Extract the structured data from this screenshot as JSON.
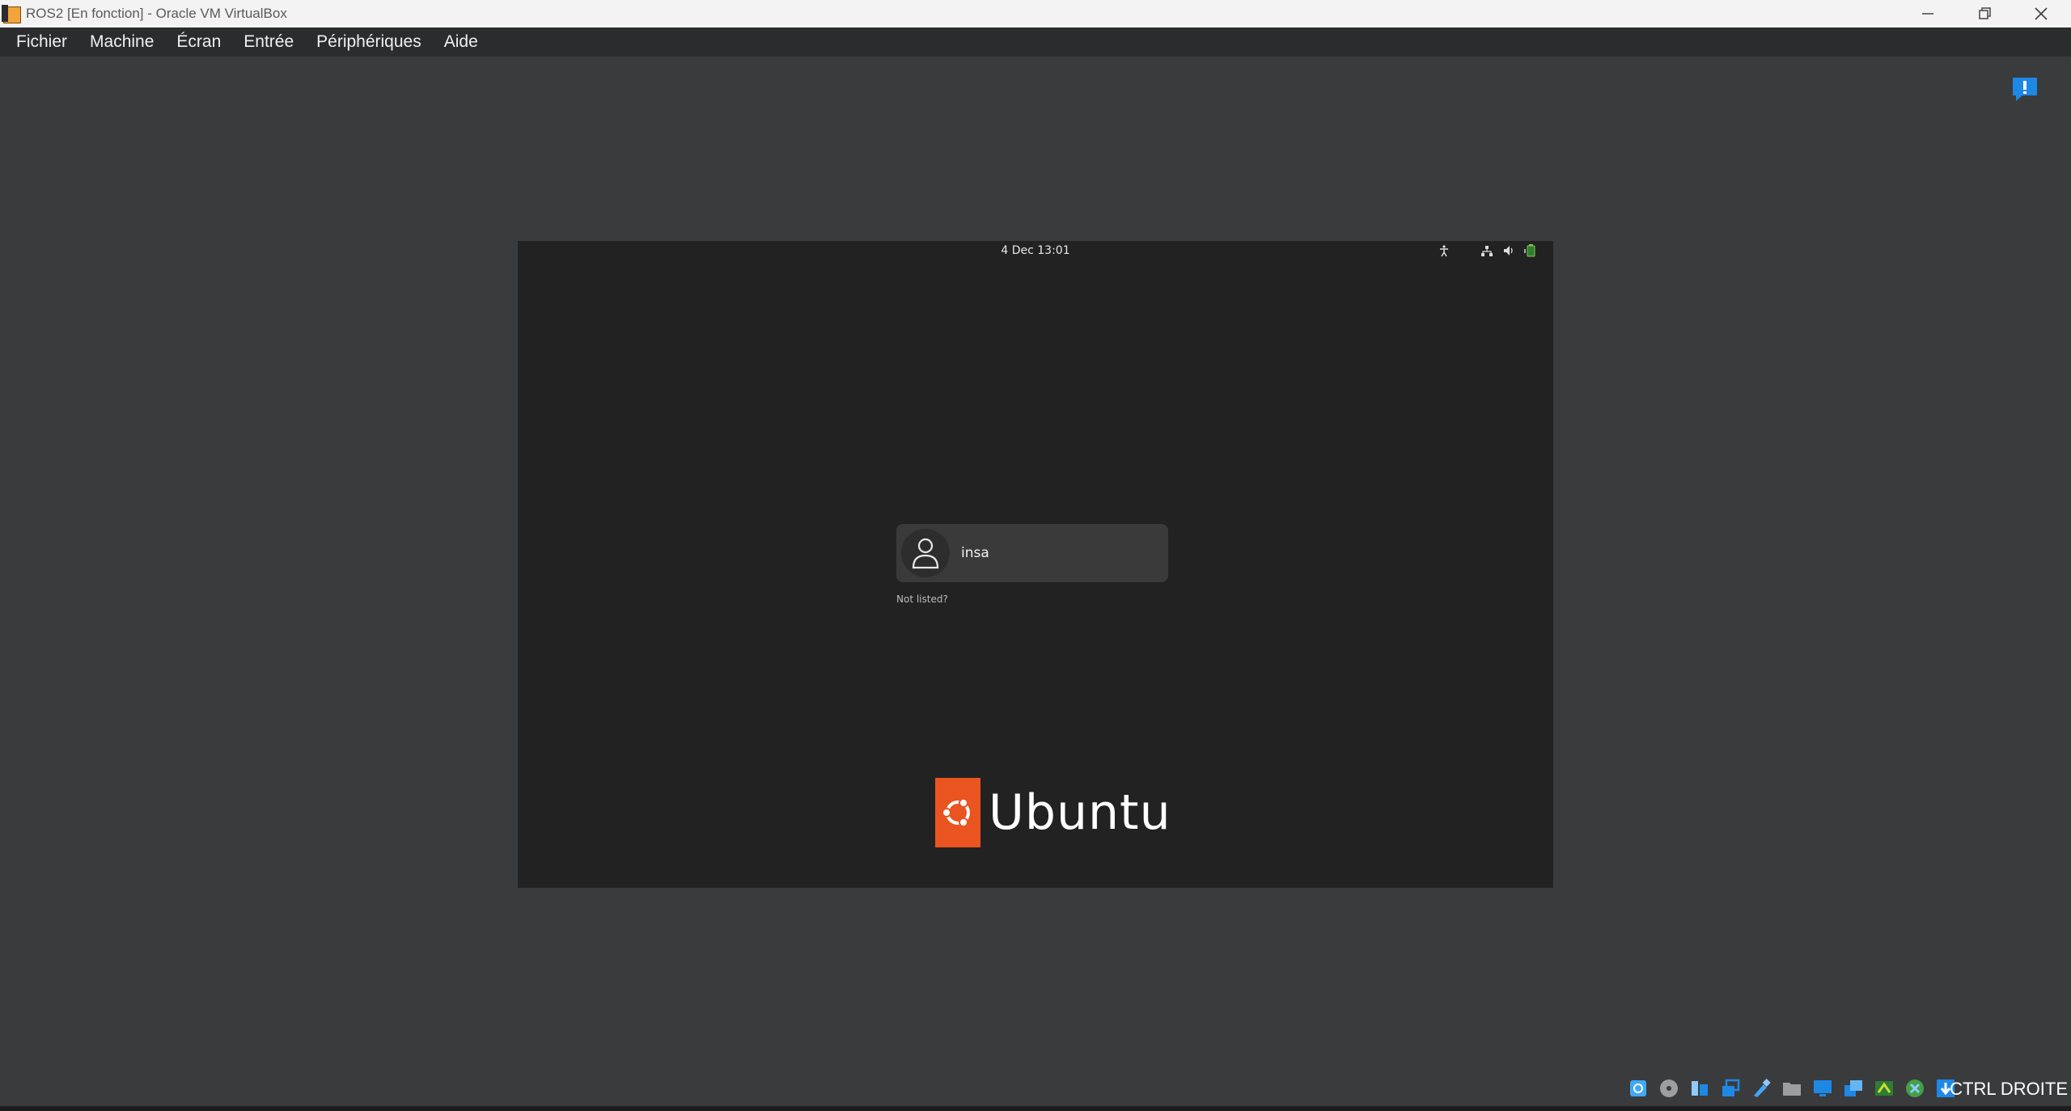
{
  "window": {
    "title": "ROS2 [En fonction] - Oracle VM VirtualBox",
    "app_icon": "virtualbox-icon",
    "controls": [
      "minimize-icon",
      "restore-icon",
      "close-icon"
    ]
  },
  "menubar": {
    "items": [
      {
        "label": "Fichier"
      },
      {
        "label": "Machine"
      },
      {
        "label": "Écran"
      },
      {
        "label": "Entrée"
      },
      {
        "label": "Périphériques"
      },
      {
        "label": "Aide"
      }
    ]
  },
  "notification_icon": "info-notification-icon",
  "vm": {
    "topbar": {
      "clock": "4 Dec  13:01",
      "tray": [
        "accessibility-icon",
        "network-icon",
        "volume-icon",
        "battery-icon"
      ]
    },
    "login": {
      "user": "insa",
      "not_listed": "Not listed?"
    },
    "brand": {
      "wordmark": "Ubuntu",
      "color": "#e95420"
    }
  },
  "statusbar": {
    "icons": [
      "hard-disk-icon",
      "optical-drive-icon",
      "audio-icon",
      "network-adapters-icon",
      "usb-icon",
      "shared-folders-icon",
      "display-icon",
      "video-capture-icon",
      "recording-icon",
      "mouse-integration-icon",
      "keyboard-capture-icon"
    ],
    "host_key": "CTRL DROITE"
  }
}
